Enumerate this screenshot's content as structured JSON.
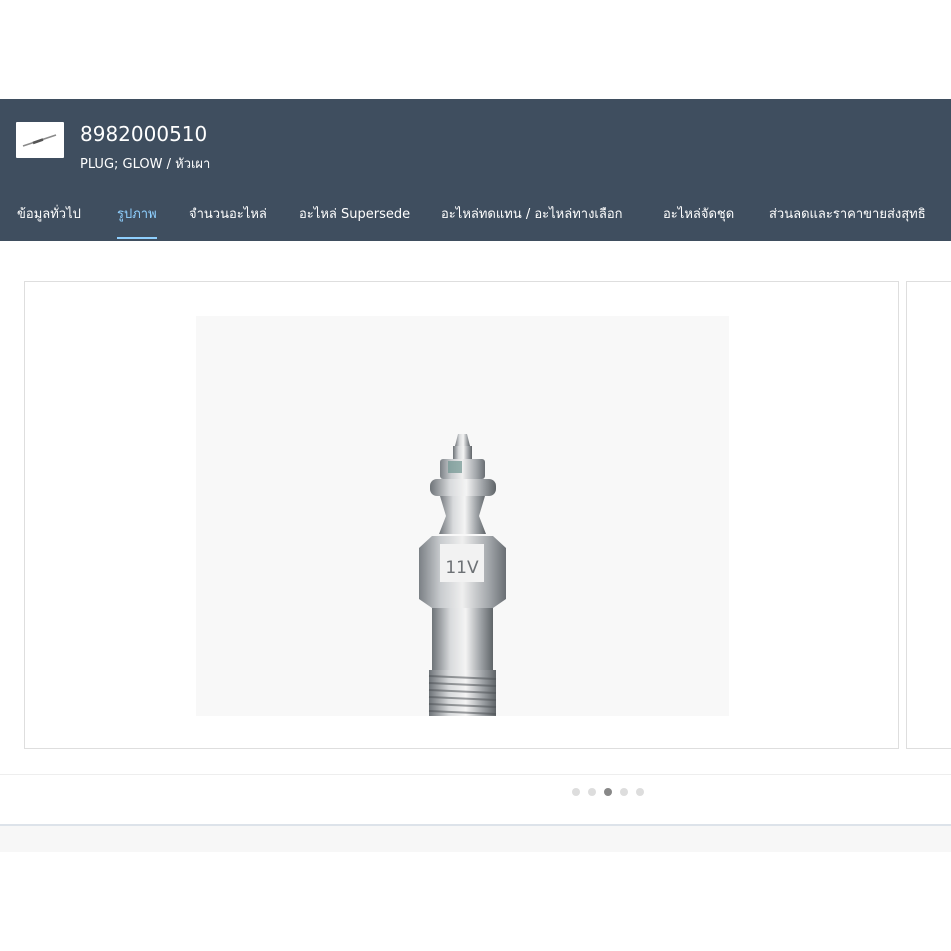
{
  "part": {
    "number": "8982000510",
    "description": "PLUG; GLOW / หัวเผา"
  },
  "tabs": [
    {
      "label": "ข้อมูลทั่วไป"
    },
    {
      "label": "รูปภาพ"
    },
    {
      "label": "จำนวนอะไหล่"
    },
    {
      "label": "อะไหล่ Supersede"
    },
    {
      "label": "อะไหล่ทดแทน / อะไหล่ทางเลือก"
    },
    {
      "label": "อะไหล่จัดชุด"
    },
    {
      "label": "ส่วนลดและราคาขายส่งสุทธิ"
    }
  ],
  "active_tab": "รูปภาพ",
  "carousel": {
    "photo_text": "11V",
    "slide_count": 5,
    "active_slide": 3
  },
  "colors": {
    "header_bg": "#3f4e5f",
    "active_tab": "#8fd0ff"
  }
}
